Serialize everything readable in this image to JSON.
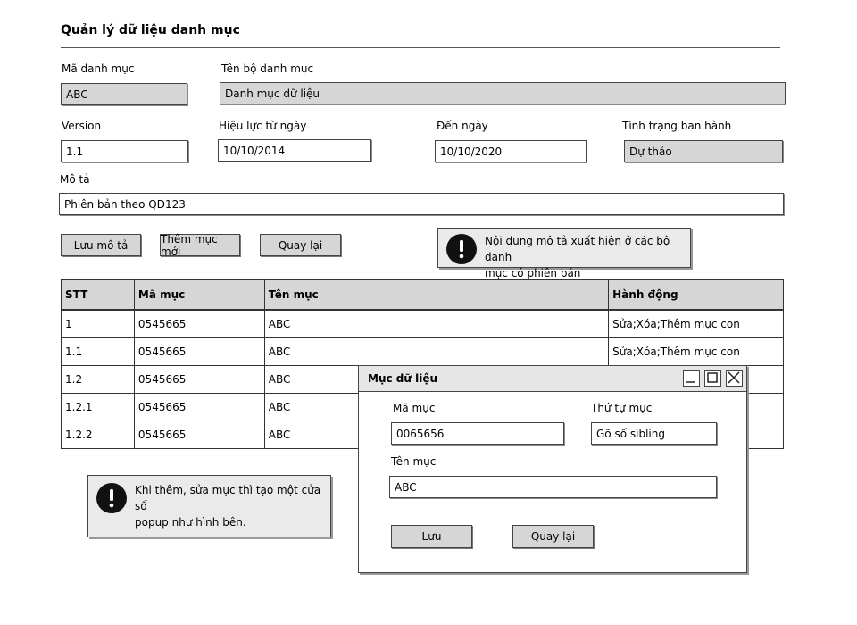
{
  "page": {
    "title": "Quản lý dữ liệu danh mục"
  },
  "form": {
    "code_label": "Mã danh mục",
    "code_value": "ABC",
    "name_label": "Tên bộ danh mục",
    "name_value": "Danh mục dữ liệu",
    "version_label": "Version",
    "version_value": "1.1",
    "from_label": "Hiệu lực từ ngày",
    "from_value": "10/10/2014",
    "to_label": "Đến ngày",
    "to_value": "10/10/2020",
    "status_label": "Tình trạng ban hành",
    "status_value": "Dự thảo",
    "desc_label": "Mô tả",
    "desc_value": "Phiên bản theo QĐ123"
  },
  "actions": {
    "save_desc": "Lưu mô tả",
    "add_item": "Thêm mục mới",
    "back": "Quay lại"
  },
  "notes": {
    "note1_line1": "Nội dung mô tả xuất hiện ở các bộ danh",
    "note1_line2": "mục có phiên bản",
    "note2_line1": "Khi thêm, sửa mục thì tạo một cửa sổ",
    "note2_line2": "popup như hình bên."
  },
  "table": {
    "headers": [
      "STT",
      "Mã mục",
      "Tên mục",
      "Hành động"
    ],
    "rows": [
      [
        "1",
        "0545665",
        "ABC",
        "Sửa;Xóa;Thêm mục con"
      ],
      [
        "1.1",
        "0545665",
        "ABC",
        "Sửa;Xóa;Thêm mục con"
      ],
      [
        "1.2",
        "0545665",
        "ABC",
        ""
      ],
      [
        "1.2.1",
        "0545665",
        "ABC",
        ""
      ],
      [
        "1.2.2",
        "0545665",
        "ABC",
        ""
      ]
    ]
  },
  "dialog": {
    "title": "Mục dữ liệu",
    "code_label": "Mã mục",
    "code_value": "0065656",
    "order_label": "Thứ tự mục",
    "order_placeholder": "Gõ số sibling",
    "name_label": "Tên mục",
    "name_value": "ABC",
    "save": "Lưu",
    "back": "Quay lại"
  },
  "icons": {
    "warning": "warning-icon",
    "minimize": "minimize-icon",
    "maximize": "maximize-icon",
    "close": "close-icon"
  }
}
